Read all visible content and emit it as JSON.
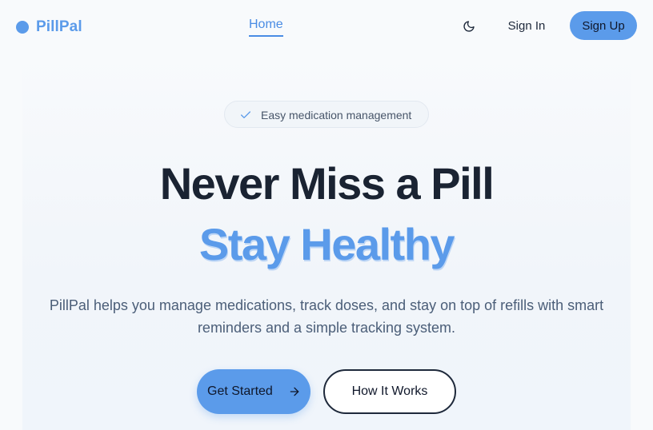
{
  "brand": {
    "name": "PillPal",
    "color": "#5b9bea"
  },
  "nav": {
    "home_label": "Home",
    "theme_icon": "moon-icon",
    "signin_label": "Sign In",
    "signup_label": "Sign Up"
  },
  "hero": {
    "badge_text": "Easy medication management",
    "badge_icon": "check-icon",
    "headline_line1": "Never Miss a Pill",
    "headline_line2": "Stay Healthy",
    "description": "PillPal helps you manage medications, track doses, and stay on top of refills with smart reminders and a simple tracking system.",
    "primary_cta": "Get Started",
    "primary_cta_icon": "arrow-right-icon",
    "secondary_cta": "How It Works"
  },
  "colors": {
    "accent": "#5b9bea",
    "heading": "#1a2332",
    "body_text": "#4b5e78",
    "background": "#f8fafc"
  }
}
